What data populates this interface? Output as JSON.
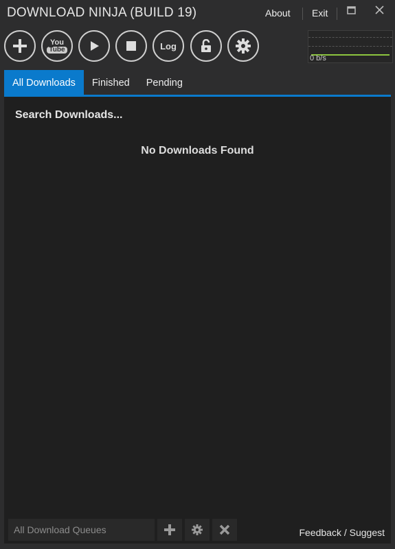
{
  "app": {
    "title": "DOWNLOAD NINJA (BUILD 19)",
    "about": "About",
    "exit": "Exit"
  },
  "toolbar": {
    "log_label": "Log",
    "youtube_top": "You",
    "youtube_bottom": "Tube"
  },
  "graph": {
    "speed": "0 b/s",
    "line_color": "#8dc63f"
  },
  "tabs": [
    {
      "label": "All Downloads",
      "active": true
    },
    {
      "label": "Finished"
    },
    {
      "label": "Pending"
    }
  ],
  "main": {
    "search_placeholder": "Search Downloads...",
    "empty_message": "No Downloads Found"
  },
  "footer": {
    "queue_select": "All Download Queues",
    "feedback": "Feedback / Suggest"
  },
  "colors": {
    "accent": "#0a7acc"
  }
}
